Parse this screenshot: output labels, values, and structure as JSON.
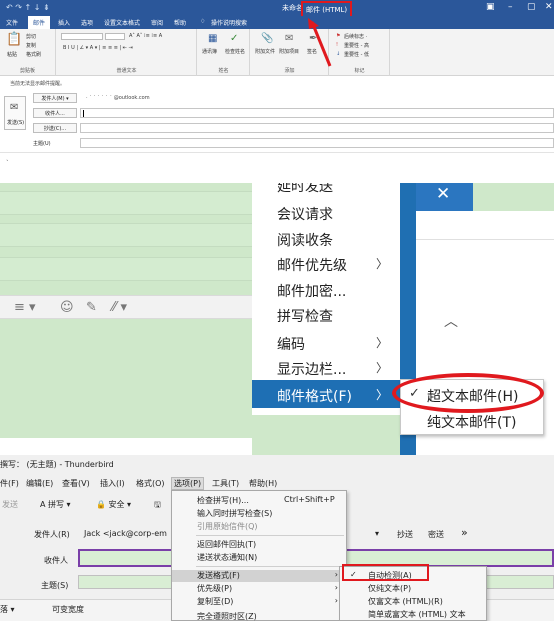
{
  "outlook": {
    "title": "未命名",
    "mode": "邮件 (HTML)",
    "qat": "↶ ↷ ↑ ↓ ⇟",
    "tabs": [
      "文件",
      "邮件",
      "插入",
      "选项",
      "设置文本格式",
      "审阅",
      "帮助"
    ],
    "tell_me": "操作说明搜索",
    "groups": [
      "剪贴板",
      "普通文本",
      "姓名",
      "添加",
      "标记"
    ],
    "clipboard": {
      "paste": "粘贴",
      "cut": "剪切",
      "copy": "复制",
      "painter": "格式刷"
    },
    "names": {
      "addr_book": "通讯簿",
      "check_names": "检查姓名"
    },
    "add": {
      "attach_file": "附加文件",
      "attach_item": "附加项目",
      "signature": "签名"
    },
    "tags": {
      "follow_up": "后续标志 ·",
      "high": "重要性 - 高",
      "low": "重要性 - 低"
    },
    "info": "当前无法显示邮件提醒。",
    "send": "发送(S)",
    "from_btn": "发件人(M) ▾",
    "from_acc": "· ˙ ˙ ˙ ˙ ˙ ˙ @outlook.com",
    "to_btn": "收件人...",
    "cc_btn": "抄送(C)...",
    "subject": "主题(U)"
  },
  "tb_zoom": {
    "menu_items": [
      "延时发送",
      "会议请求",
      "阅读收条",
      "邮件优先级",
      "邮件加密...",
      "拼写检查",
      "编码",
      "显示边栏...",
      "邮件格式(F)"
    ],
    "submenu": [
      "超文本邮件(H)",
      "纯文本邮件(T)"
    ],
    "check": "✓",
    "close": "✕",
    "chev_up": "︿",
    "editbar": [
      "≡ ▾",
      "☺",
      "✎",
      "⁄⁄ ▾"
    ]
  },
  "tb": {
    "title": "撰写： (无主题) - Thunderbird",
    "menubar": [
      "件(F)",
      "编辑(E)",
      "查看(V)",
      "插入(I)",
      "格式(O)",
      "选项(P)",
      "工具(T)",
      "帮助(H)"
    ],
    "toolbar": [
      "发送",
      "A 拼写 ▾",
      "🔒 安全 ▾",
      "🖫"
    ],
    "from_label": "发件人(R)",
    "from_value": "Jack <jack@corp-em",
    "to_label": "收件人",
    "subject_label": "主题(S)",
    "cc": "抄送",
    "bcc": "密送",
    "more": "»",
    "dropdown": "▾",
    "fmtbar": [
      "落 ▾",
      "可变宽度"
    ],
    "menu": [
      {
        "label": "检查拼写(H)...",
        "shortcut": "Ctrl+Shift+P"
      },
      {
        "label": "输入同时拼写检查(S)"
      },
      {
        "label": "引用原始信件(Q)"
      },
      {
        "label": "返回邮件回执(T)"
      },
      {
        "label": "递送状态通知(N)"
      },
      {
        "label": "发送格式(F)"
      },
      {
        "label": "优先级(P)"
      },
      {
        "label": "复制至(D)"
      },
      {
        "label": "完全遵照时区(Z)"
      }
    ],
    "submenu": [
      "自动检测(A)",
      "仅纯文本(P)",
      "仅富文本 (HTML)(R)",
      "简单或富文本 (HTML) 文本"
    ],
    "check": "✓",
    "arrow": "›"
  }
}
